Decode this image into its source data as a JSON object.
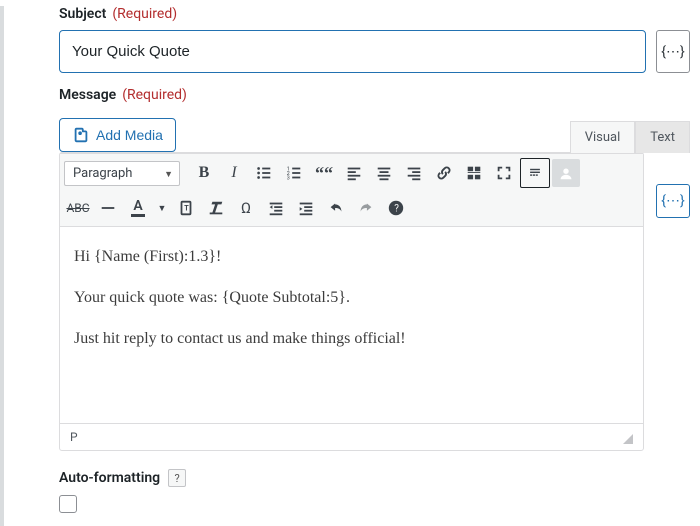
{
  "subject": {
    "label": "Subject",
    "required": "(Required)",
    "value": "Your Quick Quote"
  },
  "message": {
    "label": "Message",
    "required": "(Required)",
    "add_media": "Add Media",
    "tabs": {
      "visual": "Visual",
      "text": "Text"
    },
    "format_select": "Paragraph",
    "body": {
      "p1": "Hi {Name (First):1.3}!",
      "p2": "Your quick quote was: {Quote Subtotal:5}.",
      "p3": "Just hit reply to contact us and make things official!"
    },
    "path": "P"
  },
  "autoformat": {
    "label": "Auto-formatting",
    "help": "?"
  },
  "toolbar_icons": {
    "bold": "B",
    "italic": "I",
    "abc": "ABC",
    "a": "A",
    "omega": "Ω",
    "help": "?"
  },
  "merge_tag_glyph": "{⋯}"
}
